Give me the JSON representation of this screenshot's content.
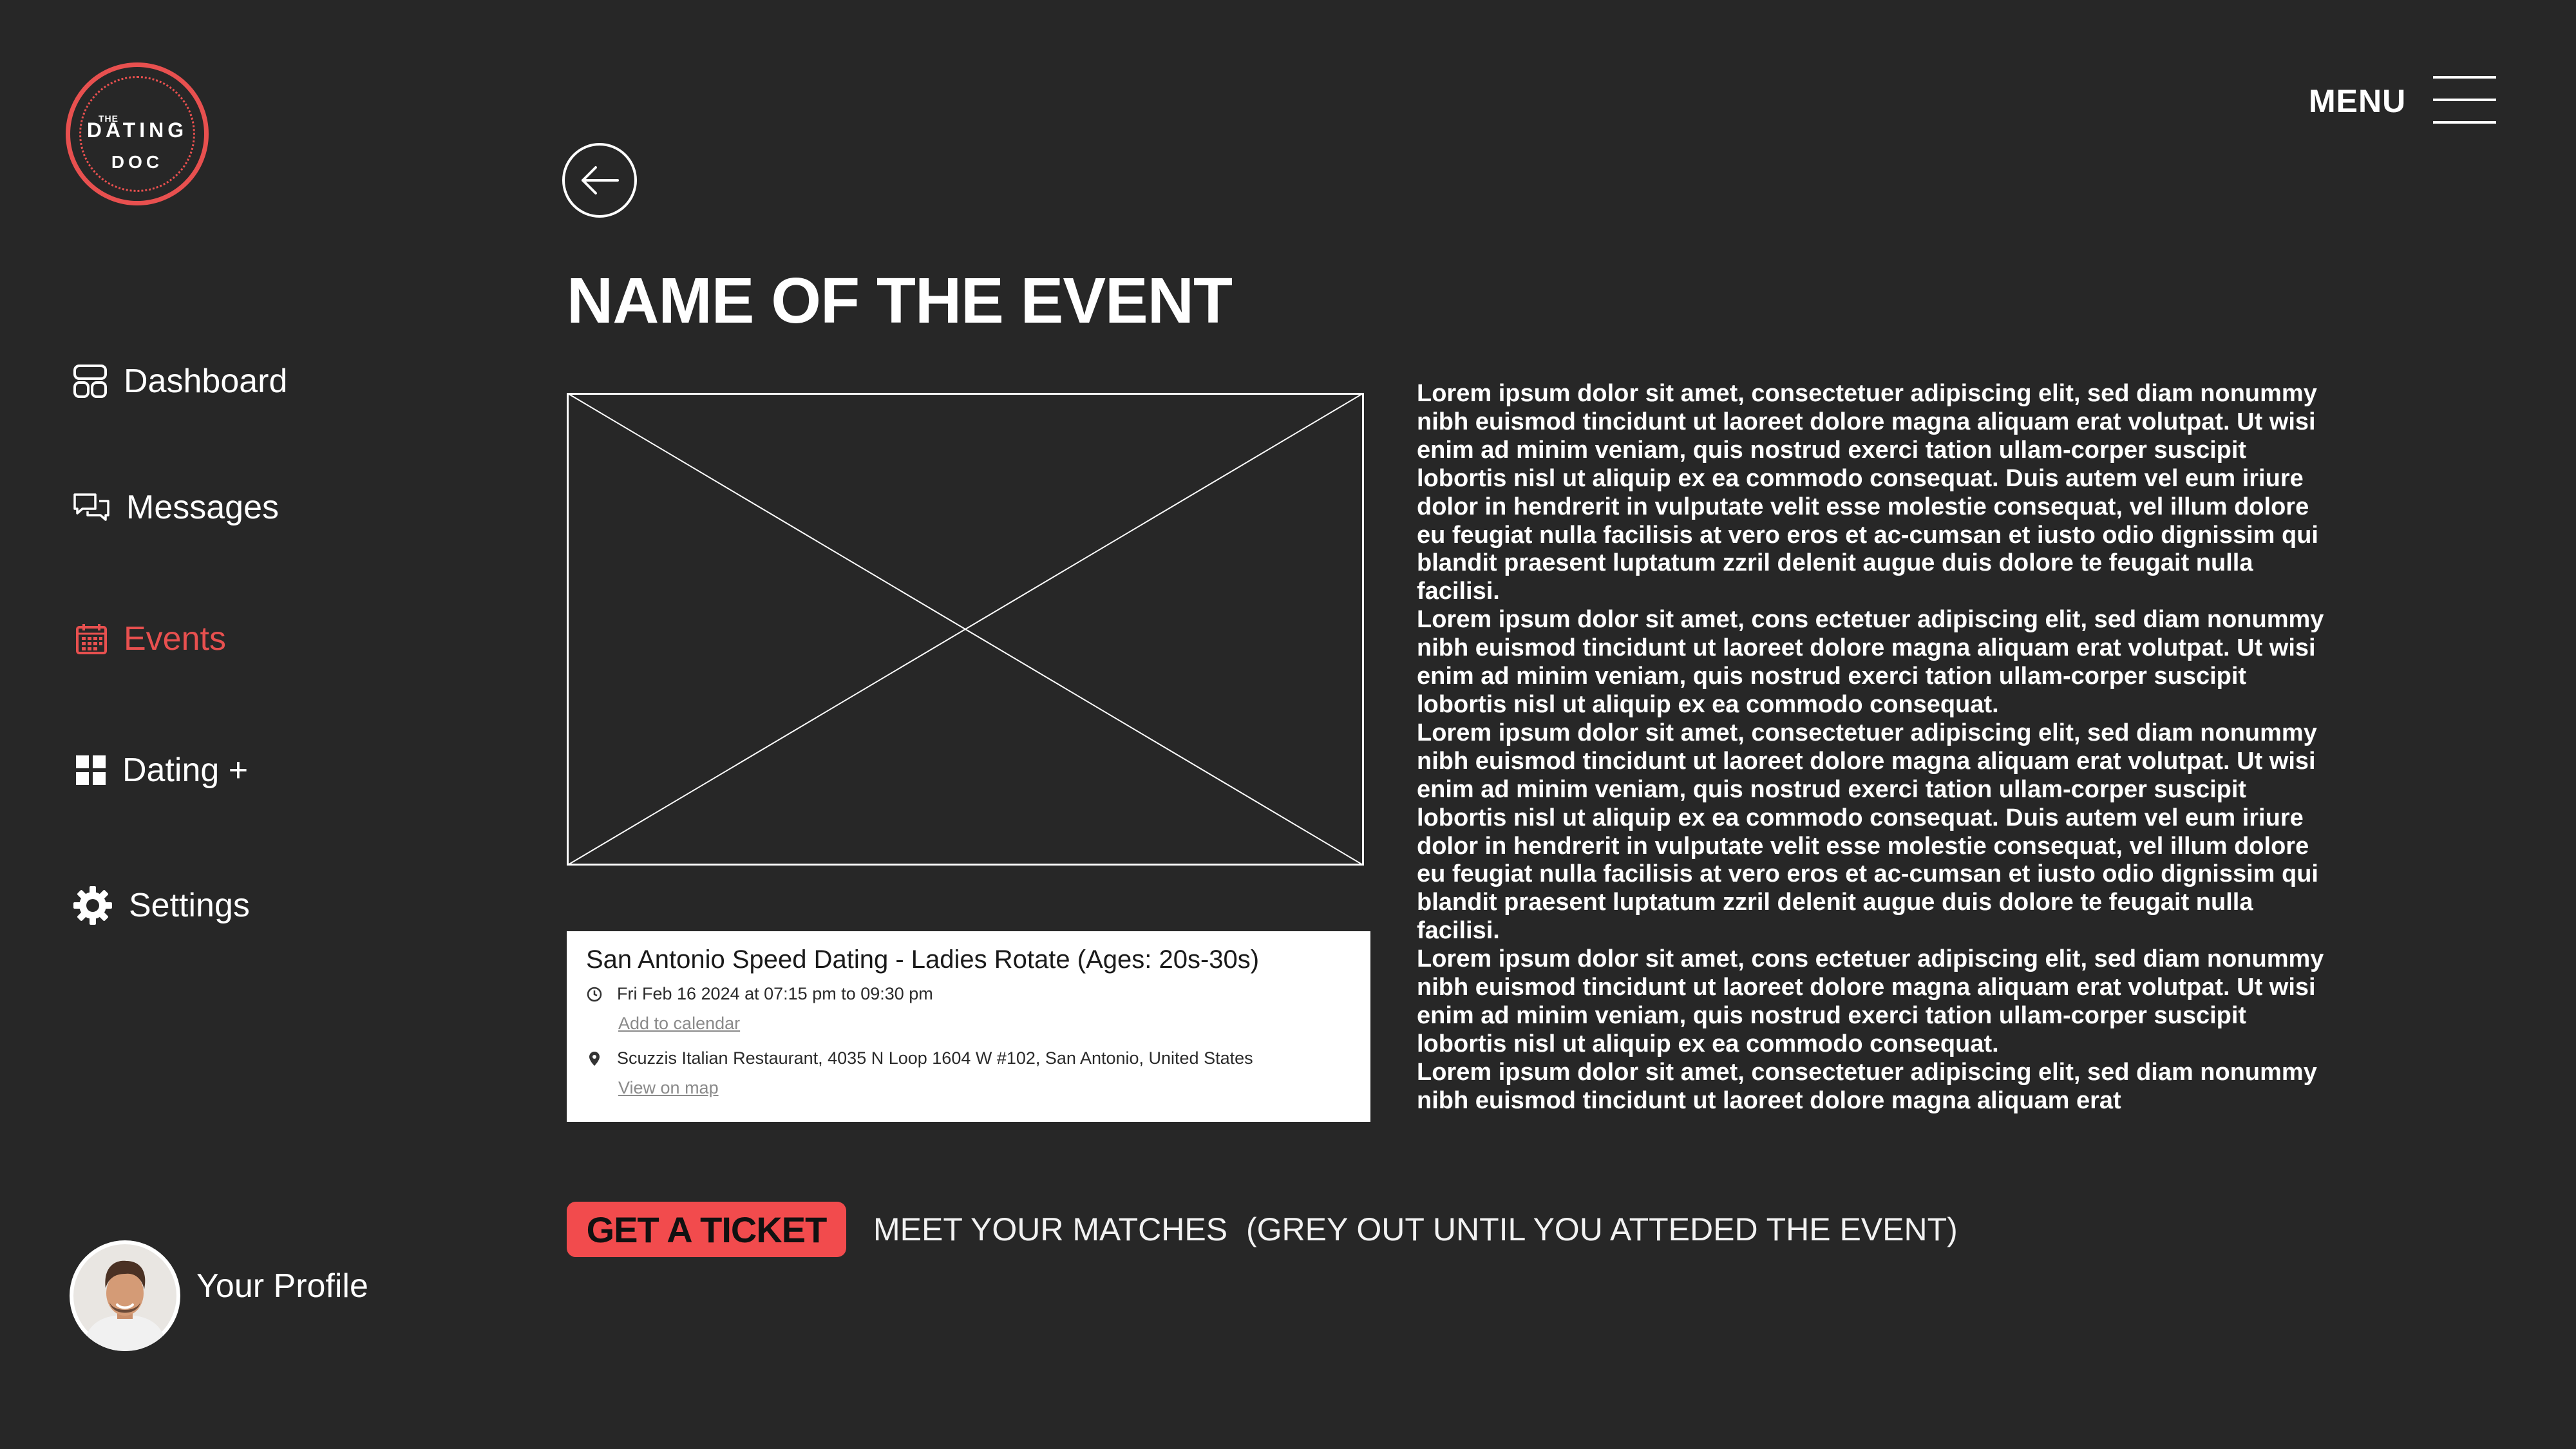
{
  "logo": {
    "small": "THE",
    "line1": "DATING",
    "line2": "DOC"
  },
  "menu": {
    "label": "MENU"
  },
  "sidebar": {
    "items": [
      {
        "label": "Dashboard",
        "icon": "dashboard-icon"
      },
      {
        "label": "Messages",
        "icon": "messages-icon"
      },
      {
        "label": "Events",
        "icon": "calendar-icon",
        "active": true
      },
      {
        "label": "Dating +",
        "icon": "grid-icon"
      },
      {
        "label": "Settings",
        "icon": "gear-icon"
      }
    ]
  },
  "event": {
    "title": "NAME OF THE EVENT",
    "card": {
      "title": "San Antonio Speed Dating - Ladies Rotate (Ages: 20s-30s)",
      "datetime": "Fri Feb 16 2024 at 07:15 pm to 09:30 pm",
      "add_calendar": "Add to calendar",
      "location": "Scuzzis Italian Restaurant, 4035 N Loop 1604 W #102, San Antonio, United States",
      "view_map": "View on map"
    },
    "description": [
      "Lorem ipsum dolor sit amet, consectetuer adipiscing elit, sed diam nonummy nibh euismod tincidunt ut laoreet dolore magna aliquam erat volutpat. Ut wisi enim ad minim veniam, quis nostrud exerci tation ullam-corper suscipit lobortis nisl ut aliquip ex ea commodo consequat. Duis autem vel eum iriure dolor in hendrerit in vulputate velit esse molestie consequat, vel illum dolore eu feugiat nulla facilisis at vero eros et ac-cumsan et iusto odio dignissim qui blandit praesent luptatum zzril delenit augue duis dolore te feugait nulla facilisi.",
      "Lorem ipsum dolor sit amet, cons ectetuer adipiscing elit, sed diam nonummy nibh euismod tincidunt ut laoreet dolore magna aliquam erat volutpat. Ut wisi enim ad minim veniam, quis nostrud exerci tation ullam-corper suscipit lobortis nisl ut aliquip ex ea commodo consequat.",
      "Lorem ipsum dolor sit amet, consectetuer adipiscing elit, sed diam nonummy nibh euismod tincidunt ut laoreet dolore magna aliquam erat volutpat. Ut wisi enim ad minim veniam, quis nostrud exerci tation ullam-corper suscipit lobortis nisl ut aliquip ex ea commodo consequat. Duis autem vel eum iriure dolor in hendrerit in vulputate velit esse molestie consequat, vel illum dolore eu feugiat nulla facilisis at vero eros et ac-cumsan et iusto odio dignissim qui blandit praesent luptatum zzril delenit augue duis dolore te feugait nulla facilisi.",
      "Lorem ipsum dolor sit amet, cons ectetuer adipiscing elit, sed diam nonummy nibh euismod tincidunt ut laoreet dolore magna aliquam erat volutpat. Ut wisi enim ad minim veniam, quis nostrud exerci tation ullam-corper suscipit lobortis nisl ut aliquip ex ea commodo consequat.",
      "Lorem ipsum dolor sit amet, consectetuer adipiscing elit, sed diam nonummy nibh euismod tincidunt ut laoreet dolore magna aliquam erat"
    ]
  },
  "actions": {
    "ticket": "GET A TICKET",
    "meet": "MEET YOUR MATCHES",
    "note": "(GREY OUT UNTIL YOU ATTEDED THE EVENT)"
  },
  "profile": {
    "label": "Your Profile"
  },
  "colors": {
    "background": "#272727",
    "accent": "#e8504f",
    "button": "#f24b4d"
  }
}
